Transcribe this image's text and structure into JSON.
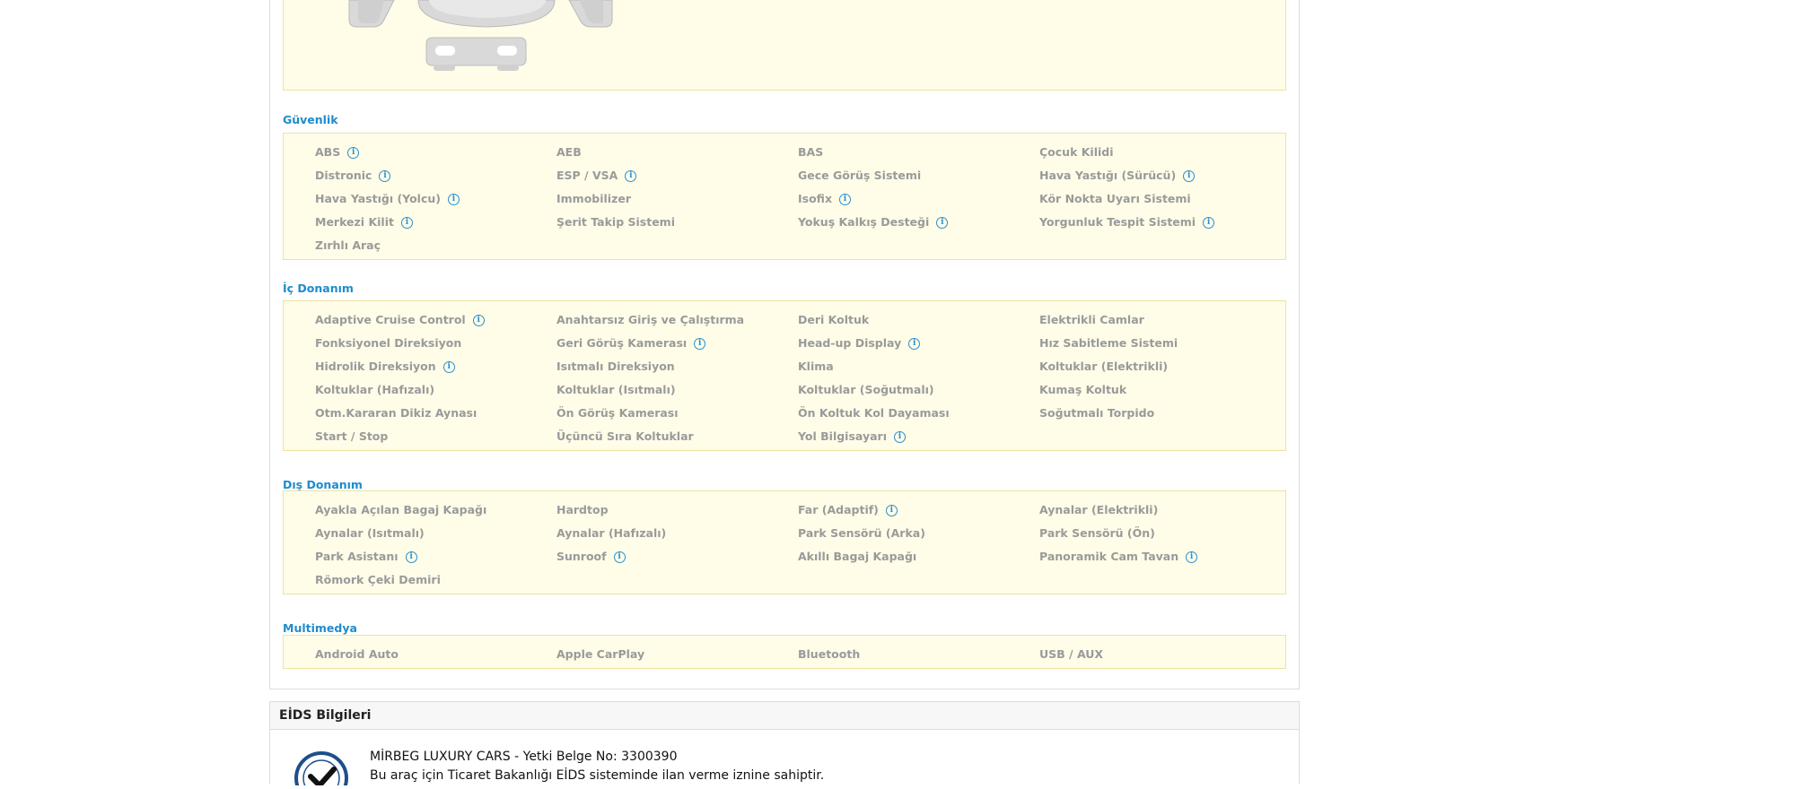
{
  "sections": [
    {
      "key": "guvenlik",
      "title": "Güvenlik",
      "items": [
        {
          "label": "ABS",
          "info": true
        },
        {
          "label": "AEB",
          "info": false
        },
        {
          "label": "BAS",
          "info": false
        },
        {
          "label": "Çocuk Kilidi",
          "info": false
        },
        {
          "label": "Distronic",
          "info": true
        },
        {
          "label": "ESP / VSA",
          "info": true
        },
        {
          "label": "Gece Görüş Sistemi",
          "info": false
        },
        {
          "label": "Hava Yastığı (Sürücü)",
          "info": true
        },
        {
          "label": "Hava Yastığı (Yolcu)",
          "info": true
        },
        {
          "label": "Immobilizer",
          "info": false
        },
        {
          "label": "Isofix",
          "info": true
        },
        {
          "label": "Kör Nokta Uyarı Sistemi",
          "info": false
        },
        {
          "label": "Merkezi Kilit",
          "info": true
        },
        {
          "label": "Şerit Takip Sistemi",
          "info": false
        },
        {
          "label": "Yokuş Kalkış Desteği",
          "info": true
        },
        {
          "label": "Yorgunluk Tespit Sistemi",
          "info": true
        },
        {
          "label": "Zırhlı Araç",
          "info": false
        }
      ]
    },
    {
      "key": "ic-donanim",
      "title": "İç Donanım",
      "items": [
        {
          "label": "Adaptive Cruise Control",
          "info": true
        },
        {
          "label": "Anahtarsız Giriş ve Çalıştırma",
          "info": false
        },
        {
          "label": "Deri Koltuk",
          "info": false
        },
        {
          "label": "Elektrikli Camlar",
          "info": false
        },
        {
          "label": "Fonksiyonel Direksiyon",
          "info": false
        },
        {
          "label": "Geri Görüş Kamerası",
          "info": true
        },
        {
          "label": "Head-up Display",
          "info": true
        },
        {
          "label": "Hız Sabitleme Sistemi",
          "info": false
        },
        {
          "label": "Hidrolik Direksiyon",
          "info": true
        },
        {
          "label": "Isıtmalı Direksiyon",
          "info": false
        },
        {
          "label": "Klima",
          "info": false
        },
        {
          "label": "Koltuklar (Elektrikli)",
          "info": false
        },
        {
          "label": "Koltuklar (Hafızalı)",
          "info": false
        },
        {
          "label": "Koltuklar (Isıtmalı)",
          "info": false
        },
        {
          "label": "Koltuklar (Soğutmalı)",
          "info": false
        },
        {
          "label": "Kumaş Koltuk",
          "info": false
        },
        {
          "label": "Otm.Kararan Dikiz Aynası",
          "info": false
        },
        {
          "label": "Ön Görüş Kamerası",
          "info": false
        },
        {
          "label": "Ön Koltuk Kol Dayaması",
          "info": false
        },
        {
          "label": "Soğutmalı Torpido",
          "info": false
        },
        {
          "label": "Start / Stop",
          "info": false
        },
        {
          "label": "Üçüncü Sıra Koltuklar",
          "info": false
        },
        {
          "label": "Yol Bilgisayarı",
          "info": true
        }
      ]
    },
    {
      "key": "dis-donanim",
      "title": "Dış Donanım",
      "items": [
        {
          "label": "Ayakla Açılan Bagaj Kapağı",
          "info": false
        },
        {
          "label": "Hardtop",
          "info": false
        },
        {
          "label": "Far (Adaptif)",
          "info": true
        },
        {
          "label": "Aynalar (Elektrikli)",
          "info": false
        },
        {
          "label": "Aynalar (Isıtmalı)",
          "info": false
        },
        {
          "label": "Aynalar (Hafızalı)",
          "info": false
        },
        {
          "label": "Park Sensörü (Arka)",
          "info": false
        },
        {
          "label": "Park Sensörü (Ön)",
          "info": false
        },
        {
          "label": "Park Asistanı",
          "info": true
        },
        {
          "label": "Sunroof",
          "info": true
        },
        {
          "label": "Akıllı Bagaj Kapağı",
          "info": false
        },
        {
          "label": "Panoramik Cam Tavan",
          "info": true
        },
        {
          "label": "Römork Çeki Demiri",
          "info": false
        }
      ]
    },
    {
      "key": "multimedya",
      "title": "Multimedya",
      "items": [
        {
          "label": "Android Auto",
          "info": false
        },
        {
          "label": "Apple CarPlay",
          "info": false
        },
        {
          "label": "Bluetooth",
          "info": false
        },
        {
          "label": "USB / AUX",
          "info": false
        }
      ]
    }
  ],
  "eids": {
    "title": "EİDS Bilgileri",
    "dealer_line": "MİRBEG LUXURY CARS - Yetki Belge No: 3300390",
    "info_line": "Bu araç için Ticaret Bakanlığı EİDS sisteminde ilan verme iznine sahiptir."
  },
  "colors": {
    "section_title": "#1e8ccc",
    "box_bg": "#fffde8",
    "box_border": "#eee2a0",
    "item_text": "#9a9a9a",
    "info_icon": "#2b8fd1"
  }
}
